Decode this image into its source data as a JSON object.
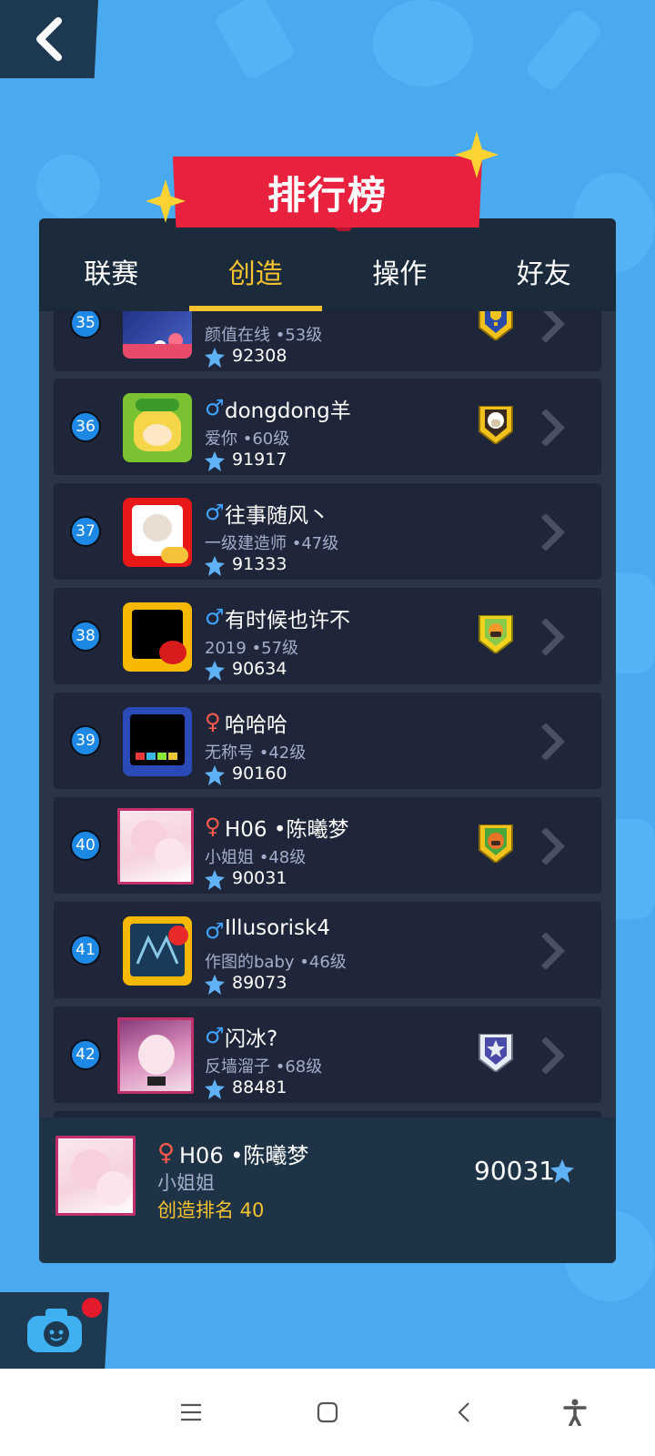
{
  "header": {
    "title": "排行榜"
  },
  "tabs": [
    {
      "label": "联赛",
      "active": false
    },
    {
      "label": "创造",
      "active": true
    },
    {
      "label": "操作",
      "active": false
    },
    {
      "label": "好友",
      "active": false
    }
  ],
  "rows": [
    {
      "rank": "35",
      "gender": "",
      "name": "",
      "subtitle": "颜值在线 •53级",
      "score": "92308",
      "badge": "trophy-badge-icon"
    },
    {
      "rank": "36",
      "gender": "♂",
      "name": "dongdong羊",
      "subtitle": "爱你 •60级",
      "score": "91917",
      "badge": "sheep-badge-icon"
    },
    {
      "rank": "37",
      "gender": "♂",
      "name": "往事随风丶",
      "subtitle": "一级建造师 •47级",
      "score": "91333",
      "badge": ""
    },
    {
      "rank": "38",
      "gender": "♂",
      "name": "有时候也许不",
      "subtitle": "2019 •57级",
      "score": "90634",
      "badge": "dog-badge-icon"
    },
    {
      "rank": "39",
      "gender": "♀",
      "name": "哈哈哈",
      "subtitle": "无称号 •42级",
      "score": "90160",
      "badge": ""
    },
    {
      "rank": "40",
      "gender": "♀",
      "name": "H06 •陈曦梦",
      "subtitle": "小姐姐 •48级",
      "score": "90031",
      "badge": "fox-badge-icon"
    },
    {
      "rank": "41",
      "gender": "♂",
      "name": "Illusorisk4",
      "subtitle": "作图的baby •46级",
      "score": "89073",
      "badge": ""
    },
    {
      "rank": "42",
      "gender": "♂",
      "name": "闪冰?",
      "subtitle": "反墙溜子 •68级",
      "score": "88481",
      "badge": "star-badge-icon"
    }
  ],
  "me": {
    "gender": "♀",
    "name": "H06 •陈曦梦",
    "subtitle": "小姐姐",
    "rank_text": "创造排名 40",
    "score": "90031"
  },
  "colors": {
    "accent": "#f5c230",
    "banner": "#e8213f",
    "panel": "#2a3548",
    "row": "#20263a",
    "rank_badge": "#1e88e5"
  }
}
